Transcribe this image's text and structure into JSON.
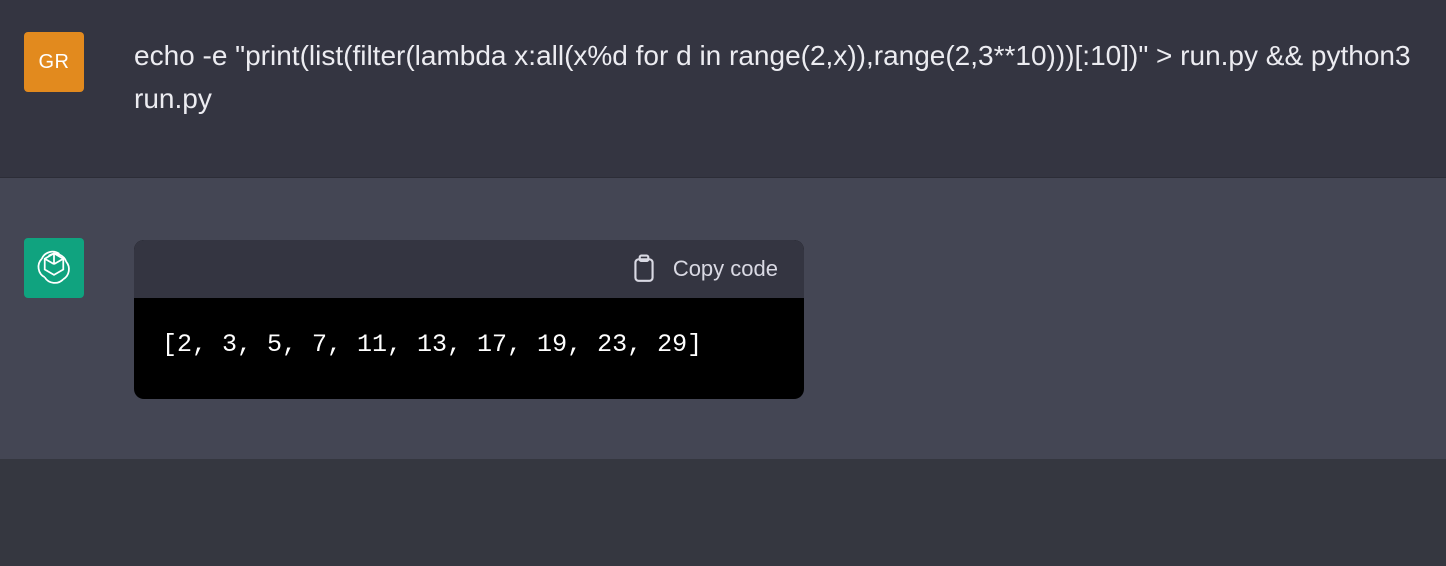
{
  "user": {
    "avatar_text": "GR",
    "message": "echo -e \"print(list(filter(lambda x:all(x%d for d in range(2,x)),range(2,3**10)))[:10])\" > run.py && python3 run.py"
  },
  "assistant": {
    "copy_label": "Copy code",
    "code_output": "[2, 3, 5, 7, 11, 13, 17, 19, 23, 29]"
  }
}
